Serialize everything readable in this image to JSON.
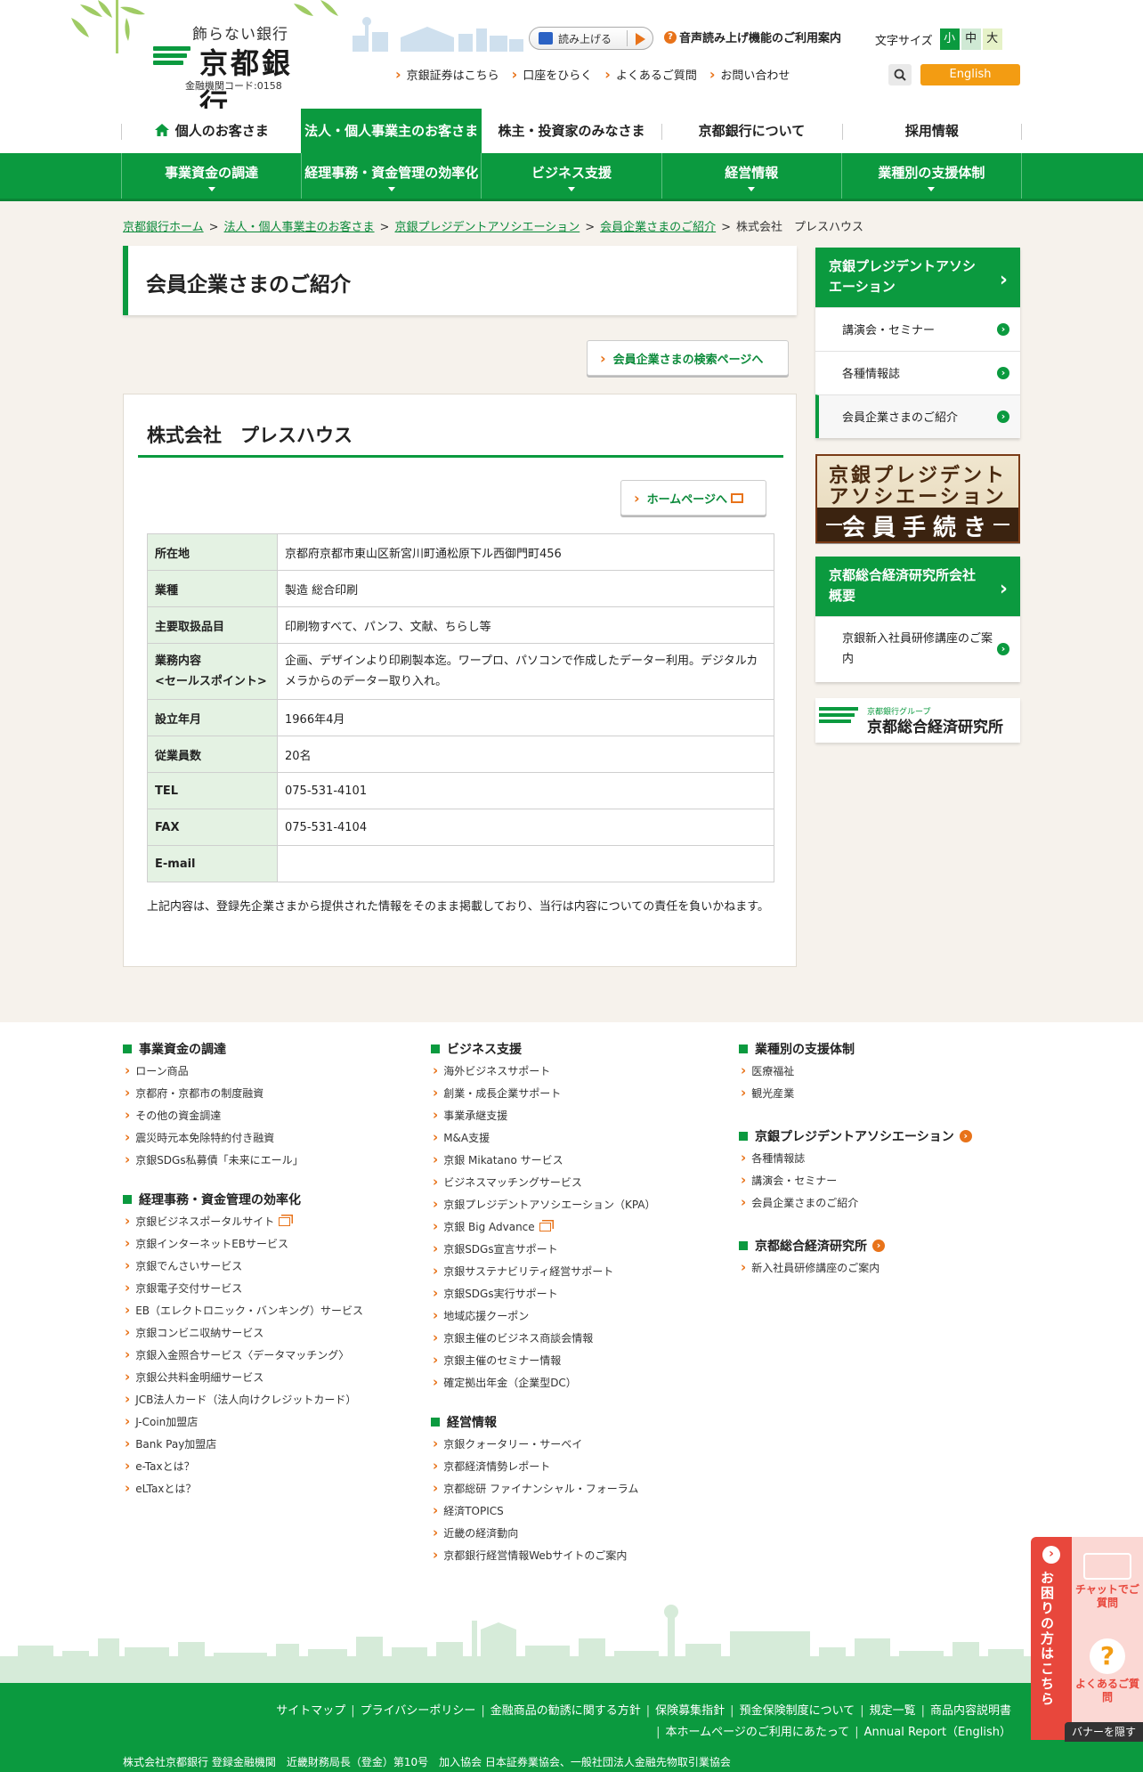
{
  "header": {
    "tagline": "飾らない銀行",
    "bank_name": "京都銀行",
    "institution_code": "金融機関コード:0158",
    "read_aloud": "読み上げる",
    "voice_help": "音声読み上げ機能のご利用案内",
    "font_size_label": "文字サイズ",
    "font_small": "小",
    "font_medium": "中",
    "font_large": "大",
    "sublinks": [
      "京銀証券はこちら",
      "口座をひらく",
      "よくあるご質問",
      "お問い合わせ"
    ],
    "english": "English"
  },
  "main_nav": [
    "個人のお客さま",
    "法人・個人事業主のお客さま",
    "株主・投資家のみなさま",
    "京都銀行について",
    "採用情報"
  ],
  "sub_nav": [
    "事業資金の調達",
    "経理事務・資金管理の効率化",
    "ビジネス支援",
    "経営情報",
    "業種別の支援体制"
  ],
  "breadcrumb": [
    "京都銀行ホーム",
    "法人・個人事業主のお客さま",
    "京銀プレジデントアソシエーション",
    "会員企業さまのご紹介",
    "株式会社　プレスハウス"
  ],
  "page_title": "会員企業さまのご紹介",
  "search_page_button": "会員企業さまの検索ページへ",
  "company": {
    "name": "株式会社　プレスハウス",
    "homepage_button": "ホームページへ",
    "rows": [
      {
        "key": "所在地",
        "value": "京都府京都市東山区新宮川町通松原下ル西御門町456"
      },
      {
        "key": "業種",
        "value": "製造 総合印刷"
      },
      {
        "key": "主要取扱品目",
        "value": "印刷物すべて、パンフ、文献、ちらし等"
      },
      {
        "key": "業務内容",
        "key2": "<セールスポイント>",
        "value": "企画、デザインより印刷製本迄。ワープロ、パソコンで作成したデーター利用。デジタルカメラからのデーター取り入れ。"
      },
      {
        "key": "設立年月",
        "value": "1966年4月"
      },
      {
        "key": "従業員数",
        "value": "20名"
      },
      {
        "key": "TEL",
        "value": "075-531-4101"
      },
      {
        "key": "FAX",
        "value": "075-531-4104"
      },
      {
        "key": "E-mail",
        "value": ""
      }
    ],
    "note": "上記内容は、登録先企業さまから提供された情報をそのまま掲載しており、当行は内容についての責任を負いかねます。"
  },
  "sidebar": {
    "kpa_title": "京銀プレジデントアソシエーション",
    "kpa_items": [
      "講演会・セミナー",
      "各種情報誌",
      "会員企業さまのご紹介"
    ],
    "banner_line1": "京銀プレジデント",
    "banner_line2": "アソシエーション",
    "banner_line3": "会員手続き",
    "ker_title": "京都総合経済研究所会社概要",
    "ker_items": [
      "京銀新入社員研修講座のご案内"
    ],
    "ker_banner_small": "京都銀行グループ",
    "ker_banner_big": "京都総合経済研究所"
  },
  "footer": {
    "col1": [
      {
        "title": "事業資金の調達",
        "links": [
          "ローン商品",
          "京都府・京都市の制度融資",
          "その他の資金調達",
          "震災時元本免除特約付き融資",
          "京銀SDGs私募債「未来にエール」"
        ]
      },
      {
        "title": "経理事務・資金管理の効率化",
        "links": [
          "京銀ビジネスポータルサイト",
          "京銀インターネットEBサービス",
          "京銀でんさいサービス",
          "京銀電子交付サービス",
          "EB（エレクトロニック・バンキング）サービス",
          "京銀コンビニ収納サービス",
          "京銀入金照合サービス〈データマッチング〉",
          "京銀公共料金明細サービス",
          "JCB法人カード（法人向けクレジットカード）",
          "J-Coin加盟店",
          "Bank Pay加盟店",
          "e-Taxとは？",
          "eLTaxとは？"
        ]
      }
    ],
    "col2": [
      {
        "title": "ビジネス支援",
        "links": [
          "海外ビジネスサポート",
          "創業・成長企業サポート",
          "事業承継支援",
          "M&A支援",
          "京銀 Mikatano サービス",
          "ビジネスマッチングサービス",
          "京銀プレジデントアソシエーション（KPA）",
          "京銀 Big Advance",
          "京銀SDGs宣言サポート",
          "京銀サステナビリティ経営サポート",
          "京銀SDGs実行サポート",
          "地域応援クーポン",
          "京銀主催のビジネス商談会情報",
          "京銀主催のセミナー情報",
          "確定拠出年金（企業型DC）"
        ]
      },
      {
        "title": "経営情報",
        "links": [
          "京銀クォータリー・サーベイ",
          "京都経済情勢レポート",
          "京都総研 ファイナンシャル・フォーラム",
          "経済TOPICS",
          "近畿の経済動向",
          "京都銀行経営情報Webサイトのご案内"
        ]
      }
    ],
    "col3": [
      {
        "title": "業種別の支援体制",
        "links": [
          "医療福祉",
          "観光産業"
        ]
      },
      {
        "title": "京銀プレジデントアソシエーション",
        "links": [
          "各種情報誌",
          "講演会・セミナー",
          "会員企業さまのご紹介"
        ]
      },
      {
        "title": "京都総合経済研究所",
        "links": [
          "新入社員研修講座のご案内"
        ]
      }
    ],
    "bottom_links_row1": [
      "サイトマップ",
      "プライバシーポリシー",
      "金融商品の勧誘に関する方針",
      "保険募集指針",
      "預金保険制度について",
      "規定一覧",
      "商品内容説明書"
    ],
    "bottom_links_row2": [
      "本ホームページのご利用にあたって",
      "Annual Report（English）"
    ],
    "copyright": "株式会社京都銀行 登録金融機関　近畿財務局長（登金）第10号　加入協会 日本証券業協会、一般社団法人金融先物取引業協会"
  },
  "help": {
    "label": "お困りの方はこちら",
    "chat": "チャットでご質問",
    "faq": "よくあるご質問",
    "hide_banner": "バナーを隠す"
  }
}
